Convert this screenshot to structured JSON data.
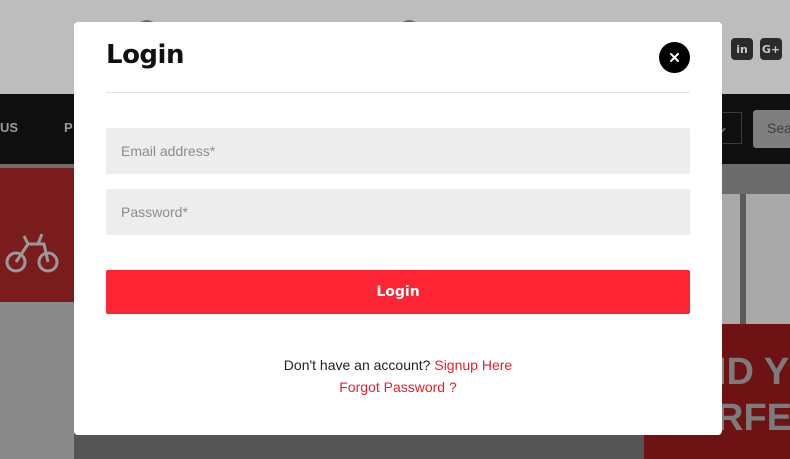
{
  "background": {
    "nav_items": [
      "US",
      "P"
    ],
    "search_placeholder": "Sea",
    "banner_text": [
      "ID Y",
      "RFEC"
    ],
    "social_icons": [
      "in",
      "G+"
    ]
  },
  "modal": {
    "title": "Login",
    "close_label": "×",
    "email_placeholder": "Email address*",
    "password_placeholder": "Password*",
    "login_button": "Login",
    "signup_prompt": "Don't have an account? ",
    "signup_link": "Signup Here",
    "forgot_link": "Forgot Password ?"
  },
  "colors": {
    "accent": "#fd2433",
    "link": "#e8202f",
    "field_bg": "#ededed",
    "overlay": "#7d7d7d"
  }
}
